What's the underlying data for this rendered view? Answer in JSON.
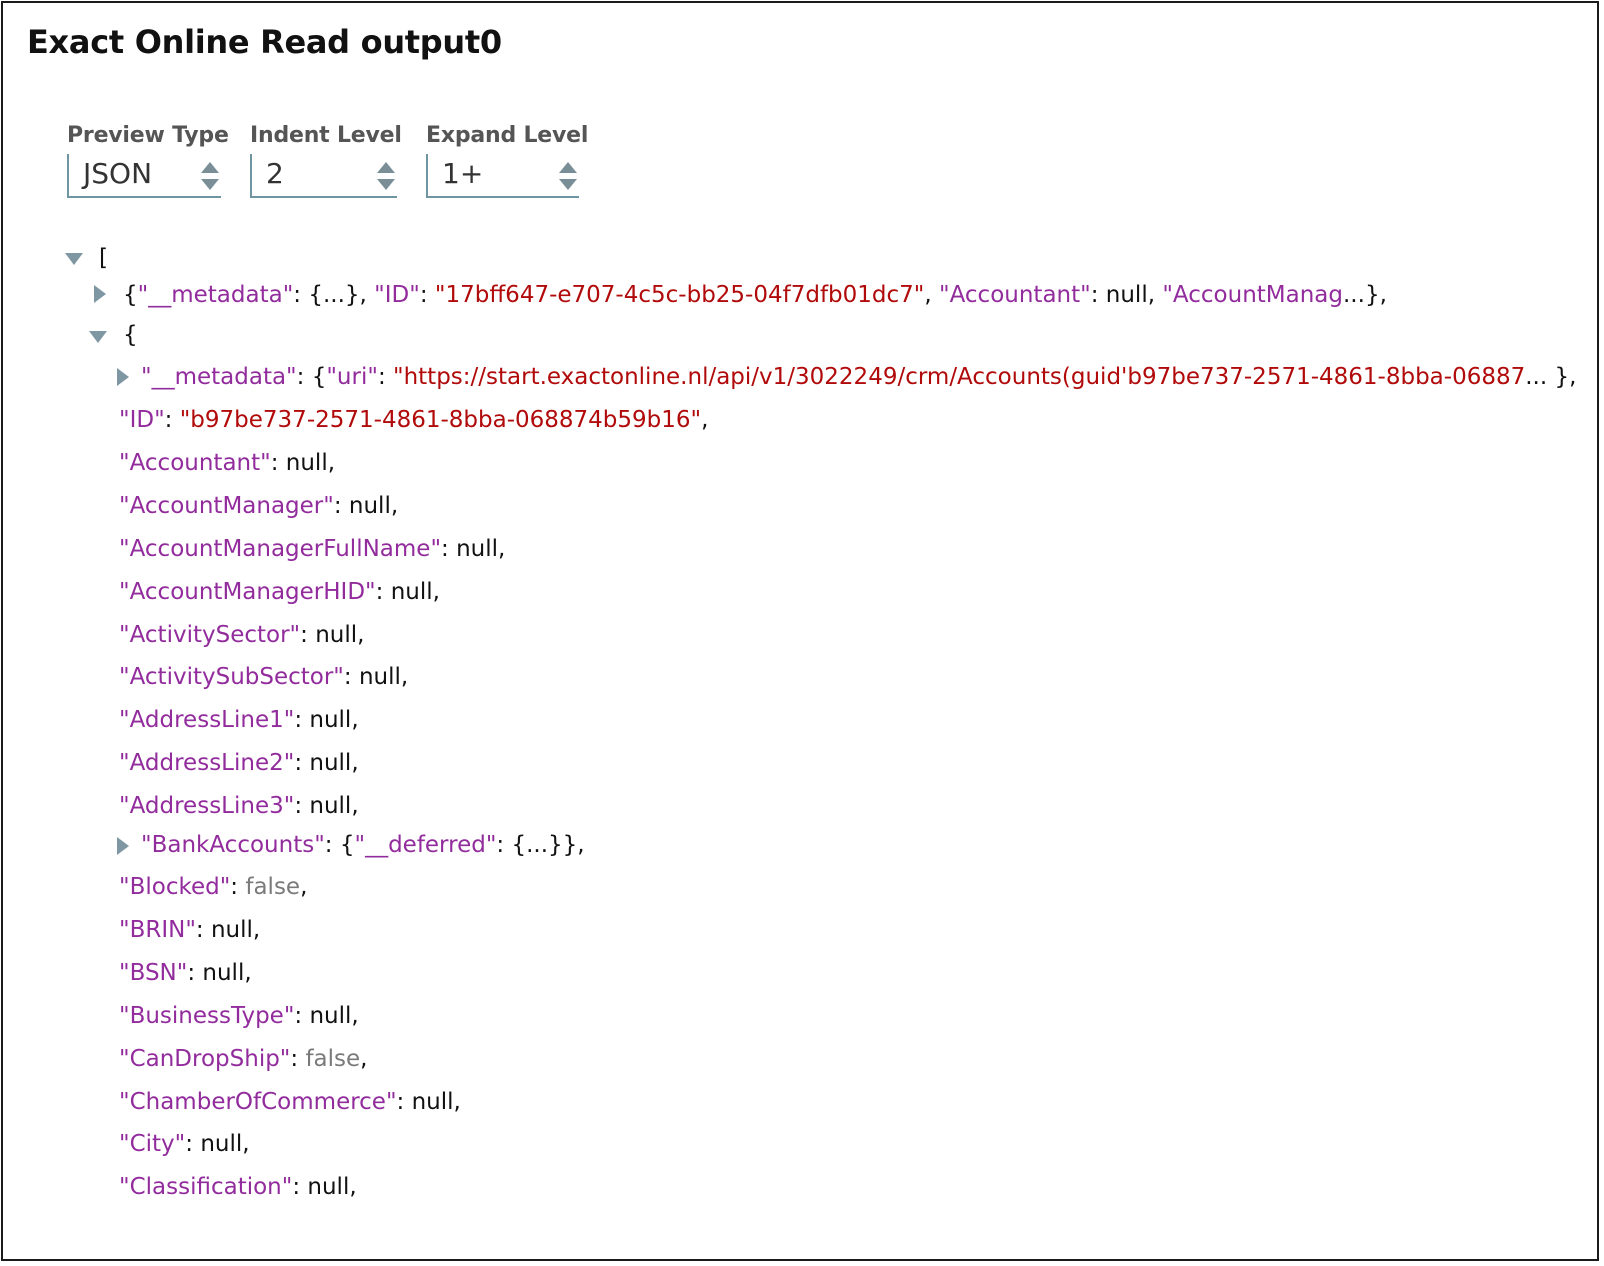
{
  "title": "Exact Online Read output0",
  "controls": {
    "preview_type": {
      "label": "Preview Type",
      "value": "JSON"
    },
    "indent_level": {
      "label": "Indent Level",
      "value": "2"
    },
    "expand_level": {
      "label": "Expand Level",
      "value": "1+"
    }
  },
  "tree": {
    "root_open": "[",
    "item1": {
      "open": "{",
      "k_metadata": "\"__metadata\"",
      "colon1": ": ",
      "collapsed_obj": "{...}",
      "comma1": ", ",
      "k_id": "\"ID\"",
      "colon2": ": ",
      "v_id": "\"17bff647-e707-4c5c-bb25-04f7dfb01dc7\"",
      "comma2": ", ",
      "k_accountant": "\"Accountant\"",
      "colon3": ": ",
      "v_accountant": "null",
      "comma3": ", ",
      "k_trunc": "\"AccountManag",
      "ellipsis": "...",
      "close": "},"
    },
    "item2_open": "{",
    "metadata_row": {
      "key": "\"__metadata\"",
      "colon": ": ",
      "open": "{",
      "uri_key": "\"uri\"",
      "colon2": ": ",
      "uri_val": "\"https://start.exactonline.nl/api/v1/3022249/crm/Accounts(guid'b97be737-2571-4861-8bba-06887",
      "ellipsis": "... ",
      "close": "},"
    },
    "fields": [
      {
        "key": "\"ID\"",
        "value": "\"b97be737-2571-4861-8bba-068874b59b16\"",
        "type": "string"
      },
      {
        "key": "\"Accountant\"",
        "value": "null",
        "type": "null"
      },
      {
        "key": "\"AccountManager\"",
        "value": "null",
        "type": "null"
      },
      {
        "key": "\"AccountManagerFullName\"",
        "value": "null",
        "type": "null"
      },
      {
        "key": "\"AccountManagerHID\"",
        "value": "null",
        "type": "null"
      },
      {
        "key": "\"ActivitySector\"",
        "value": "null",
        "type": "null"
      },
      {
        "key": "\"ActivitySubSector\"",
        "value": "null",
        "type": "null"
      },
      {
        "key": "\"AddressLine1\"",
        "value": "null",
        "type": "null"
      },
      {
        "key": "\"AddressLine2\"",
        "value": "null",
        "type": "null"
      },
      {
        "key": "\"AddressLine3\"",
        "value": "null",
        "type": "null"
      }
    ],
    "bank_row": {
      "key": "\"BankAccounts\"",
      "colon": ": ",
      "open": "{",
      "inner_key": "\"__deferred\"",
      "colon2": ": ",
      "collapsed": "{...}",
      "close": "},"
    },
    "fields2": [
      {
        "key": "\"Blocked\"",
        "value": "false",
        "type": "bool"
      },
      {
        "key": "\"BRIN\"",
        "value": "null",
        "type": "null"
      },
      {
        "key": "\"BSN\"",
        "value": "null",
        "type": "null"
      },
      {
        "key": "\"BusinessType\"",
        "value": "null",
        "type": "null"
      },
      {
        "key": "\"CanDropShip\"",
        "value": "false",
        "type": "bool"
      },
      {
        "key": "\"ChamberOfCommerce\"",
        "value": "null",
        "type": "null"
      },
      {
        "key": "\"City\"",
        "value": "null",
        "type": "null"
      },
      {
        "key": "\"Classification\"",
        "value": "null",
        "type": "null"
      }
    ],
    "colon": ": ",
    "comma": ","
  }
}
